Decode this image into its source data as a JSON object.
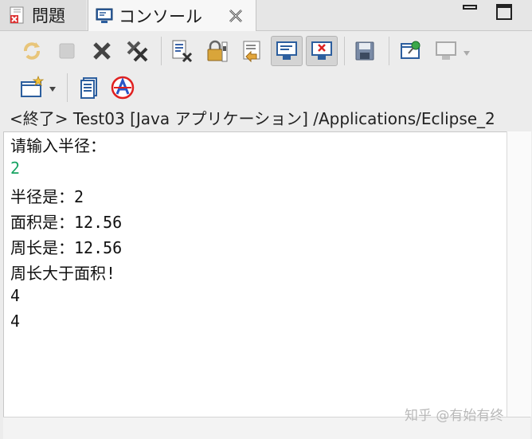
{
  "tabs": {
    "problems": {
      "label": "問題"
    },
    "console": {
      "label": "コンソール"
    }
  },
  "window_controls": [
    "minimize-icon",
    "maximize-icon"
  ],
  "toolbar": {
    "row1": [
      "relaunch-icon",
      "terminate-icon",
      "remove-launch-icon",
      "remove-all-terminated-icon",
      "clear-console-icon",
      "scroll-lock-icon",
      "show-console-when-output-icon",
      "word-wrap-icon",
      "show-standard-out-icon",
      "show-standard-error-icon",
      "save-icon",
      "pin-console-icon",
      "display-selected-console-icon"
    ],
    "row2": [
      "open-console-icon",
      "copy-icon",
      "eclipse-icon"
    ]
  },
  "process_label": "<終了> Test03 [Java アプリケーション] /Applications/Eclipse_2",
  "console_lines": [
    {
      "text": "请输入半径：",
      "kind": "output"
    },
    {
      "text": "2",
      "kind": "input"
    },
    {
      "text": "半径是：2",
      "kind": "output"
    },
    {
      "text": "面积是：12.56",
      "kind": "output"
    },
    {
      "text": "周长是：12.56",
      "kind": "output"
    },
    {
      "text": "周长大于面积!",
      "kind": "output"
    },
    {
      "text": "4",
      "kind": "output"
    },
    {
      "text": "4",
      "kind": "output"
    }
  ],
  "watermark": "知乎 @有始有终",
  "colors": {
    "input_text": "#17a362",
    "output_text": "#111111"
  }
}
